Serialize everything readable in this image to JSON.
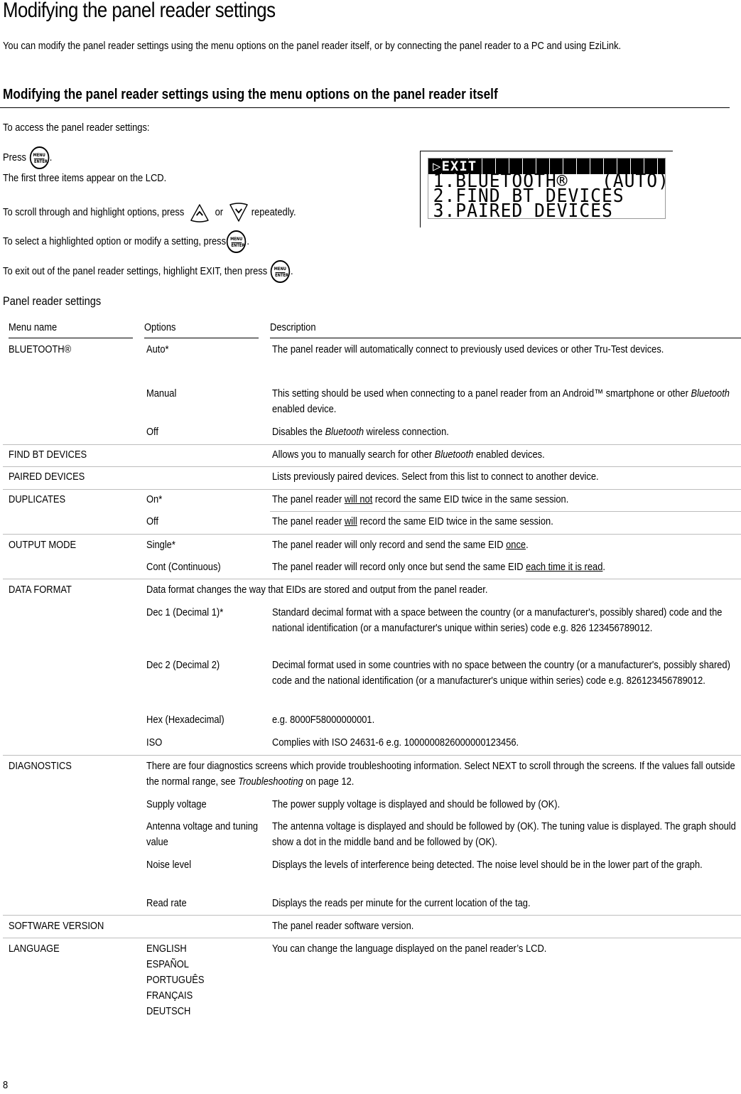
{
  "page": {
    "title": "Modifying the panel reader settings",
    "intro": "You can modify the panel reader settings using the menu options on the panel reader itself, or by connecting the panel reader to a PC and using EziLink.",
    "section_heading": "Modifying the panel reader settings using the menu options on the panel reader itself",
    "page_number": "8"
  },
  "steps": {
    "access": "To access the panel reader settings:",
    "press_prefix": "Press",
    "press_suffix": ".",
    "lcd_note": "The first three items appear on the LCD.",
    "scroll_prefix": "To scroll through and highlight options, press",
    "scroll_or": "or",
    "scroll_suffix": "repeatedly.",
    "select_prefix": "To select a highlighted option or modify a setting, press",
    "select_suffix": ".",
    "exit_prefix": "To exit out of the panel reader settings, highlight EXIT, then press",
    "exit_suffix": "."
  },
  "icons": {
    "menu_enter_top": "MENU",
    "menu_enter_bottom": "ENTER",
    "up": "up-arrow-button",
    "down": "down-arrow-button"
  },
  "lcd": {
    "highlighted": "▷EXIT",
    "lines": [
      "1.BLUETOOTH®   (AUTO)",
      "2.FIND BT DEVICES",
      "3.PAIRED DEVICES"
    ]
  },
  "table": {
    "title": "Panel reader settings",
    "headers": [
      "Menu name",
      "Options",
      "Description"
    ],
    "rows": {
      "bluetooth": {
        "menu": "BLUETOOTH®",
        "auto_option": "Auto*",
        "auto_desc": "The panel reader will automatically connect to previously used devices or other Tru-Test devices.",
        "manual_option": "Manual",
        "manual_desc_a": "This setting should be used when connecting to a panel reader from an Android™ smartphone or other ",
        "manual_desc_em": "Bluetooth",
        "manual_desc_b": " enabled device.",
        "off_option": "Off",
        "off_desc_a": "Disables the ",
        "off_desc_em": "Bluetooth",
        "off_desc_b": " wireless connection."
      },
      "find_bt": {
        "menu": "FIND BT DEVICES",
        "desc_a": "Allows you to manually search for other ",
        "desc_em": "Bluetooth",
        "desc_b": " enabled devices."
      },
      "paired": {
        "menu": "PAIRED DEVICES",
        "desc": "Lists previously paired devices. Select from this list to connect to another device."
      },
      "duplicates": {
        "menu": "DUPLICATES",
        "on_option": "On*",
        "on_desc_a": "The panel reader ",
        "on_desc_u": "will not",
        "on_desc_b": " record the same EID twice in the same session.",
        "off_option": "Off",
        "off_desc_a": "The panel reader ",
        "off_desc_u": "will",
        "off_desc_b": " record the same EID twice in the same session."
      },
      "output_mode": {
        "menu": "OUTPUT MODE",
        "single_option": "Single*",
        "single_desc_a": "The panel reader will only record and send the same EID ",
        "single_desc_u": "once",
        "single_desc_b": ".",
        "cont_option": "Cont (Continuous)",
        "cont_desc_a": "The panel reader will record only once but send the same EID ",
        "cont_desc_u": "each time it is read",
        "cont_desc_b": "."
      },
      "data_format": {
        "menu": "DATA FORMAT",
        "intro": "Data format changes the way that EIDs are stored and output from the panel reader.",
        "dec1_option": "Dec 1 (Decimal 1)*",
        "dec1_desc": "Standard decimal format with a space between the country (or a manufacturer's, possibly shared) code and the national identification (or a manufacturer's unique within series) code e.g. 826 123456789012.",
        "dec2_option": "Dec 2 (Decimal 2)",
        "dec2_desc": "Decimal format used in some countries with no space between the country (or a manufacturer's, possibly shared) code and the national identification (or a manufacturer's unique within series) code e.g. 826123456789012.",
        "hex_option": "Hex (Hexadecimal)",
        "hex_desc": "e.g. 8000F58000000001.",
        "iso_option": "ISO",
        "iso_desc": "Complies with ISO 24631-6 e.g. 1000000826000000123456."
      },
      "diagnostics": {
        "menu": "DIAGNOSTICS",
        "intro_a": "There are four diagnostics screens which provide troubleshooting information. Select NEXT to scroll through the screens. If the values fall outside the normal range, see ",
        "intro_em": "Troubleshooting",
        "intro_b": " on page 12.",
        "supply_option": "Supply voltage",
        "supply_desc": "The power supply voltage is displayed and should be followed by (OK).",
        "antenna_option": "Antenna voltage and tuning value",
        "antenna_desc": "The antenna voltage is displayed and should be followed by (OK). The tuning value is displayed. The graph should show a dot in the middle band and be followed by (OK).",
        "noise_option": "Noise level",
        "noise_desc": "Displays the levels of interference being detected. The noise level should be in the lower part of the graph.",
        "readrate_option": "Read rate",
        "readrate_desc": "Displays the reads per minute for the current location of the tag."
      },
      "software_version": {
        "menu": "SOFTWARE VERSION",
        "desc": "The panel reader software version."
      },
      "language": {
        "menu": "LANGUAGE",
        "options": [
          "ENGLISH",
          "ESPAÑOL",
          "PORTUGUÊS",
          "FRANÇAIS",
          "DEUTSCH"
        ],
        "desc": "You can change the language displayed on the panel reader’s LCD."
      }
    }
  }
}
